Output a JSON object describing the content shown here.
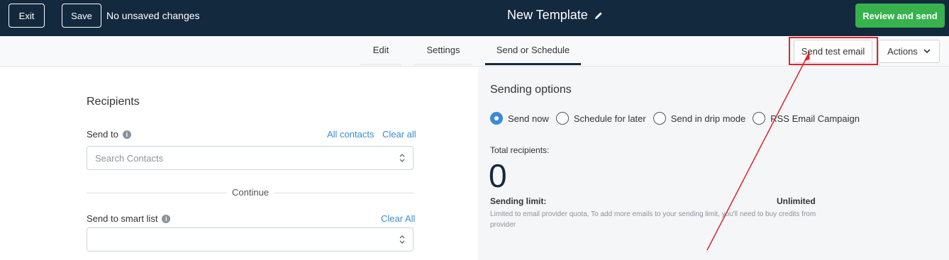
{
  "header": {
    "exit_label": "Exit",
    "save_label": "Save",
    "status_text": "No unsaved changes",
    "title": "New Template",
    "review_label": "Review and send",
    "icons": {
      "edit": "pencil-icon"
    }
  },
  "tabs": [
    {
      "label": "Edit"
    },
    {
      "label": "Settings"
    },
    {
      "label": "Send or Schedule",
      "active": true
    }
  ],
  "toolbar": {
    "test_email_label": "Send test email",
    "actions_label": "Actions"
  },
  "recipients": {
    "title": "Recipients",
    "send_to_label": "Send to",
    "all_contacts_link": "All contacts",
    "clear_all_link": "Clear all",
    "search_placeholder": "Search Contacts",
    "continue_text": "Continue",
    "smart_list_label": "Send to smart list",
    "smart_list_clear": "Clear All",
    "smart_list_value": ""
  },
  "sending": {
    "title": "Sending options",
    "options": [
      {
        "label": "Send now",
        "checked": true
      },
      {
        "label": "Schedule for later",
        "checked": false
      },
      {
        "label": "Send in drip mode",
        "checked": false
      },
      {
        "label": "RSS Email Campaign",
        "checked": false
      }
    ],
    "total_label": "Total recipients:",
    "total_value": "0",
    "limit_label": "Sending limit:",
    "limit_value": "Unlimited",
    "limit_note": "Limited to email provider quota, To add more emails to your sending limit, you'll need to buy credits from provider"
  },
  "colors": {
    "header_bg": "#13293d",
    "review_button": "#37b24d",
    "link": "#3b8bd3",
    "annotation": "#e0242c"
  }
}
